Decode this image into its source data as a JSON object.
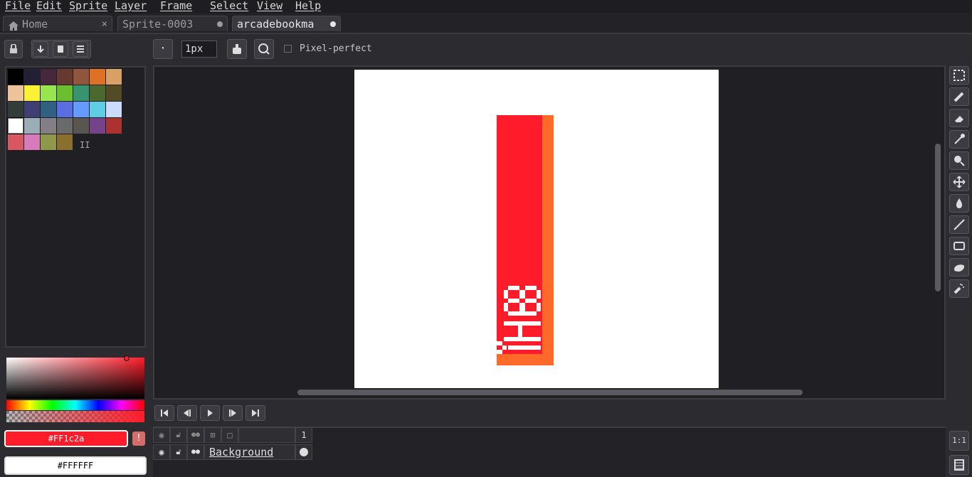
{
  "menu": {
    "file": "File",
    "edit": "Edit",
    "sprite": "Sprite",
    "layer": "Layer",
    "frame": "Frame",
    "select": "Select",
    "view": "View",
    "help": "Help"
  },
  "tabs": [
    {
      "label": "Home"
    },
    {
      "label": "Sprite-0003"
    },
    {
      "label": "arcadebookma"
    }
  ],
  "tool_options": {
    "brush_size": "1px",
    "pixel_perfect_label": "Pixel-perfect"
  },
  "palette": {
    "colors": [
      "#000000",
      "#222034",
      "#45283c",
      "#663931",
      "#8f563b",
      "#df7126",
      "#d9a066",
      "#eec39a",
      "#fbf236",
      "#99e550",
      "#6abe30",
      "#37946e",
      "#4b692f",
      "#524b24",
      "#323c39",
      "#3f3f74",
      "#306082",
      "#5b6ee1",
      "#639bff",
      "#5fcde4",
      "#cbdbfc",
      "#ffffff",
      "#9badb7",
      "#847e87",
      "#696a6a",
      "#595652",
      "#76428a",
      "#ac3232",
      "#d95763",
      "#d77bba",
      "#8f974a",
      "#8a6f30"
    ],
    "selected_index": 21
  },
  "colors": {
    "foreground": "#FF1c2a",
    "background": "#FFFFFF",
    "foreground_hex": "#ff1c2a",
    "canvas_orange": "#ff6a2a"
  },
  "timeline": {
    "frame_number": "1",
    "layer_name": "Background"
  },
  "zoom_button": "1:1"
}
